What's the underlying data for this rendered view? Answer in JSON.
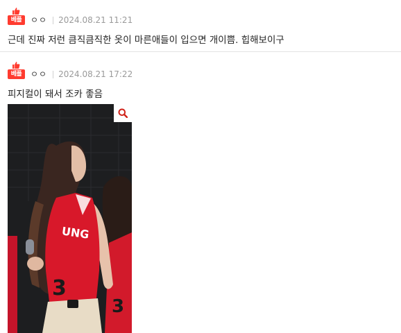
{
  "comments": [
    {
      "badge": "베플",
      "nickname": "ㅇㅇ",
      "date": "2024.08.21 11:21",
      "text": "근데 진짜 저런 큼직큼직한 옷이 마른애들이 입으면 개이쁨. 힙해보이구"
    },
    {
      "badge": "베플",
      "nickname": "ㅇㅇ",
      "date": "2024.08.21 17:22",
      "text": "피지컬이 돼서 조카 좋음",
      "image": {
        "jersey_text": "UNG",
        "jersey_number_left": "3",
        "jersey_number_right": "3"
      }
    }
  ],
  "colors": {
    "badge": "#ff3b2f",
    "jersey": "#d8182a",
    "zoom_icon": "#d0231a"
  },
  "icons": {
    "badge_icon": "thumbs-up-icon",
    "zoom_icon": "search-icon"
  }
}
